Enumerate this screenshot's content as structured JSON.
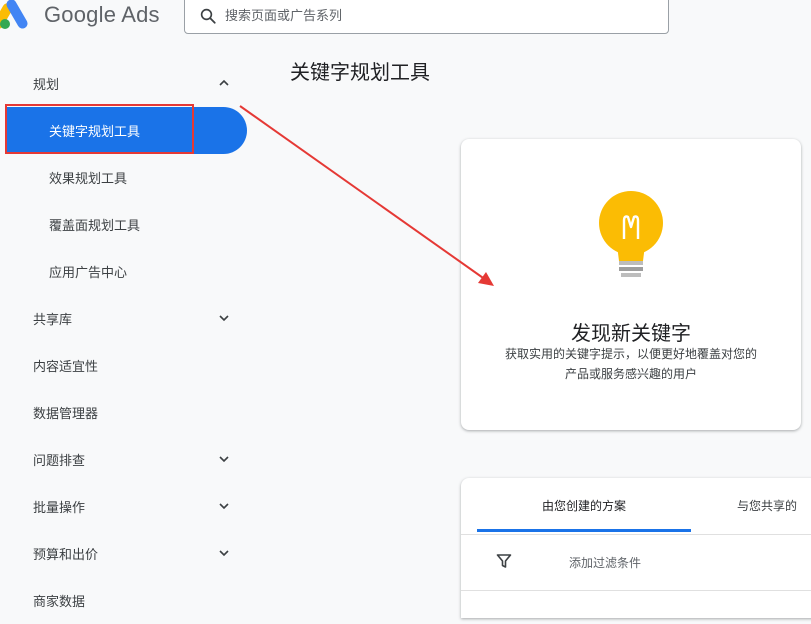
{
  "header": {
    "brand": "Google Ads",
    "search_placeholder": "搜索页面或广告系列"
  },
  "sidebar": {
    "items": [
      {
        "label": "规划",
        "chevron": "up"
      },
      {
        "label": "关键字规划工具",
        "active": true
      },
      {
        "label": "效果规划工具"
      },
      {
        "label": "覆盖面规划工具"
      },
      {
        "label": "应用广告中心"
      },
      {
        "label": "共享库",
        "chevron": "down"
      },
      {
        "label": "内容适宜性"
      },
      {
        "label": "数据管理器"
      },
      {
        "label": "问题排查",
        "chevron": "down"
      },
      {
        "label": "批量操作",
        "chevron": "down"
      },
      {
        "label": "预算和出价",
        "chevron": "down"
      },
      {
        "label": "商家数据"
      }
    ]
  },
  "main": {
    "title": "关键字规划工具",
    "card": {
      "icon": "lightbulb-icon",
      "title": "发现新关键字",
      "desc_line1": "获取实用的关键字提示，以便更好地覆盖对您的",
      "desc_line2": "产品或服务感兴趣的用户"
    },
    "tabs": [
      {
        "label": "由您创建的方案",
        "selected": true
      },
      {
        "label": "与您共享的"
      }
    ],
    "filter_label": "添加过滤条件"
  },
  "colors": {
    "accent": "#1a73e8",
    "annotation": "#e53935",
    "bulb": "#fbbc04"
  }
}
